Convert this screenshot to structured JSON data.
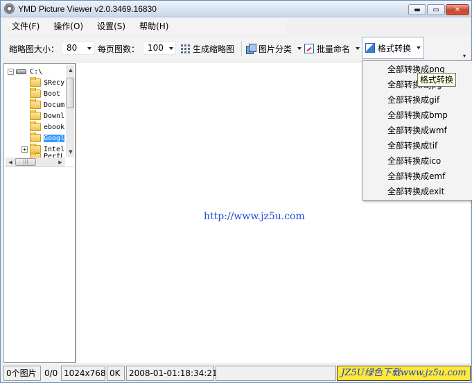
{
  "window": {
    "title": "YMD Picture Viewer v2.0.3469.16830",
    "min_glyph": "▬",
    "max_glyph": "▭",
    "close_glyph": "✕"
  },
  "menubar": {
    "items": [
      "文件(F)",
      "操作(O)",
      "设置(S)",
      "帮助(H)"
    ]
  },
  "toolbar": {
    "thumb_size_label": "缩略图大小：",
    "thumb_size_value": "80",
    "per_page_label": "每页图数：",
    "per_page_value": "100",
    "generate_thumbs": "生成缩略图",
    "classify": "图片分类",
    "batch_rename": "批量命名",
    "format_convert": "格式转换",
    "overflow_glyph": "▾"
  },
  "tree": {
    "root": "C:\\",
    "folders": [
      "$Recy",
      "Boot",
      "Docum",
      "Downl",
      "ebook",
      "Googl",
      "Intel",
      "PerfL"
    ],
    "selected_index": 5,
    "expand_minus": "−",
    "expand_plus": "+"
  },
  "dropdown": {
    "items": [
      "全部转换成png",
      "全部转换成jpg",
      "全部转换成gif",
      "全部转换成bmp",
      "全部转换成wmf",
      "全部转换成tif",
      "全部转换成ico",
      "全部转换成emf",
      "全部转换成exit"
    ],
    "tooltip": "格式转换"
  },
  "main": {
    "watermark_url": "http://www.jz5u.com"
  },
  "statusbar": {
    "count": "0个图片",
    "position": "0/0",
    "dimensions": "1024x768",
    "size": "0K",
    "datetime": "2008-01-01:18:34:21",
    "brand": "JZ5U绿色下载www.jz5u.com"
  },
  "colors": {
    "selection": "#3399ff",
    "url_blue": "#1f4bd6",
    "brand_bg": "#ffe83a"
  }
}
